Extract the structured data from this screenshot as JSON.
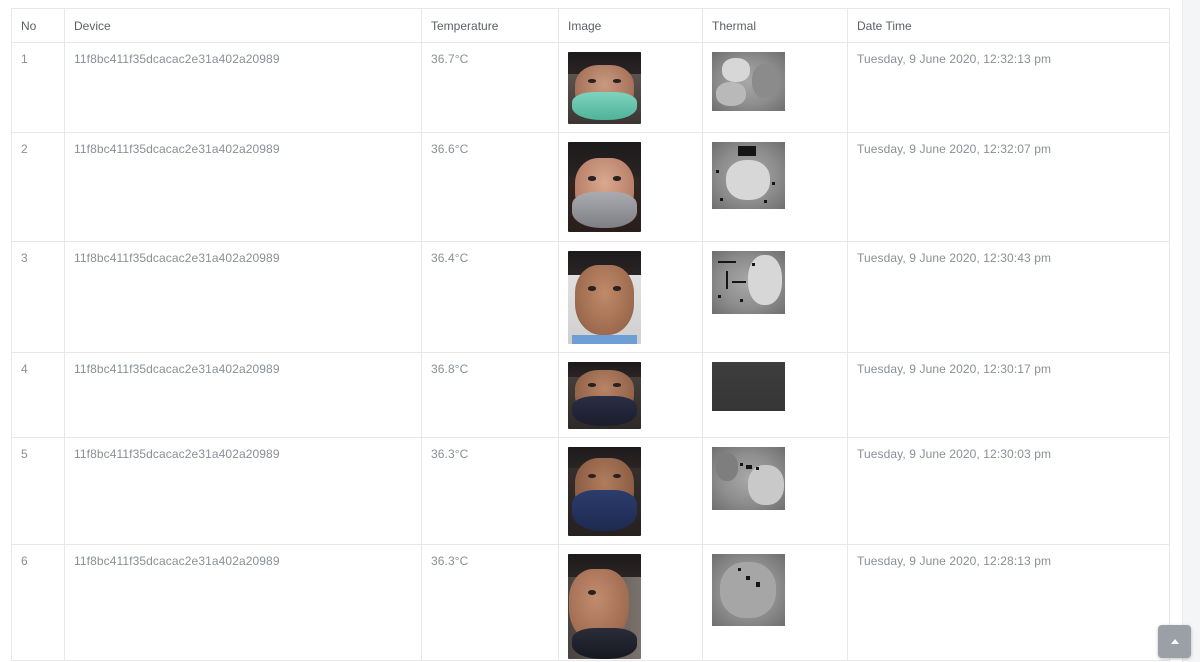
{
  "table": {
    "headers": [
      "No",
      "Device",
      "Temperature",
      "Image",
      "Thermal",
      "Date Time"
    ],
    "rows": [
      {
        "no": "1",
        "device": "11f8bc411f35dcacac2e31a402a20989",
        "temperature": "36.7°C",
        "date_time": "Tuesday, 9 June 2020, 12:32:13 pm"
      },
      {
        "no": "2",
        "device": "11f8bc411f35dcacac2e31a402a20989",
        "temperature": "36.6°C",
        "date_time": "Tuesday, 9 June 2020, 12:32:07 pm"
      },
      {
        "no": "3",
        "device": "11f8bc411f35dcacac2e31a402a20989",
        "temperature": "36.4°C",
        "date_time": "Tuesday, 9 June 2020, 12:30:43 pm"
      },
      {
        "no": "4",
        "device": "11f8bc411f35dcacac2e31a402a20989",
        "temperature": "36.8°C",
        "date_time": "Tuesday, 9 June 2020, 12:30:17 pm"
      },
      {
        "no": "5",
        "device": "11f8bc411f35dcacac2e31a402a20989",
        "temperature": "36.3°C",
        "date_time": "Tuesday, 9 June 2020, 12:30:03 pm"
      },
      {
        "no": "6",
        "device": "11f8bc411f35dcacac2e31a402a20989",
        "temperature": "36.3°C",
        "date_time": "Tuesday, 9 June 2020, 12:28:13 pm"
      }
    ]
  },
  "scroll_top": {
    "icon": "chevron-up-icon"
  },
  "colors": {
    "text": "#8a8f96",
    "header_text": "#5c6168",
    "border": "#e6e8eb",
    "scroll_button": "#9aa0a6"
  }
}
